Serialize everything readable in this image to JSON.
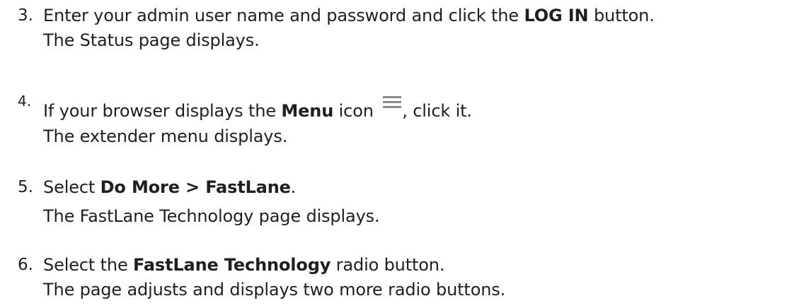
{
  "steps": [
    {
      "number": "3.",
      "line1": {
        "before": "Enter your admin user name and password and click the ",
        "bold": "LOG IN",
        "after": " button."
      },
      "line2": "The Status page displays."
    },
    {
      "number": "4.",
      "line1": {
        "before": "If your browser displays the ",
        "bold": "Menu",
        "middle": " icon ",
        "icon": "hamburger-menu-icon",
        "after": ", click it."
      },
      "line2": "The extender menu displays."
    },
    {
      "number": "5.",
      "line1": {
        "before": "Select ",
        "bold": "Do More > FastLane",
        "after": "."
      },
      "line2": "The FastLane Technology page displays."
    },
    {
      "number": "6.",
      "line1": {
        "before": "Select the ",
        "bold": "FastLane Technology",
        "after": " radio button."
      },
      "line2": "The page adjusts and displays two more radio buttons."
    }
  ]
}
